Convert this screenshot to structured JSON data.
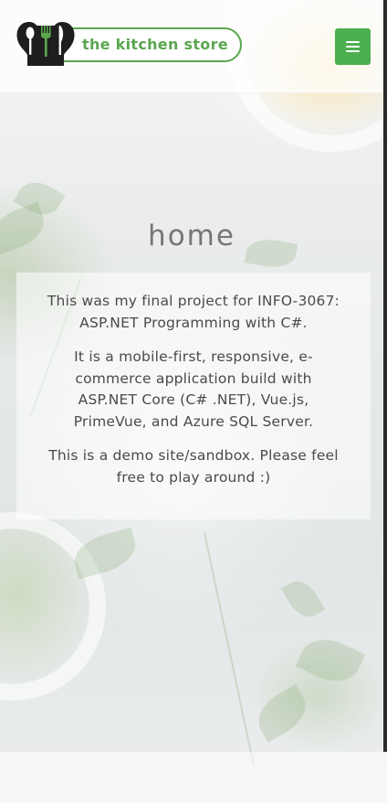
{
  "brand": {
    "name": "the kitchen store",
    "logo_icon": "spoon-fork-knife-icon",
    "accent_color": "#5aa74e"
  },
  "header": {
    "menu_icon": "hamburger-menu-icon",
    "menu_button_color": "#4caf50"
  },
  "main": {
    "title": "home",
    "paragraphs": [
      "This was my final project for INFO-3067: ASP.NET Programming with C#.",
      "It is a mobile-first, responsive, e-commerce application build with ASP.NET Core (C# .NET), Vue.js, PrimeVue, and Azure SQL Server.",
      "This is a demo site/sandbox. Please feel free to play around :)"
    ]
  }
}
